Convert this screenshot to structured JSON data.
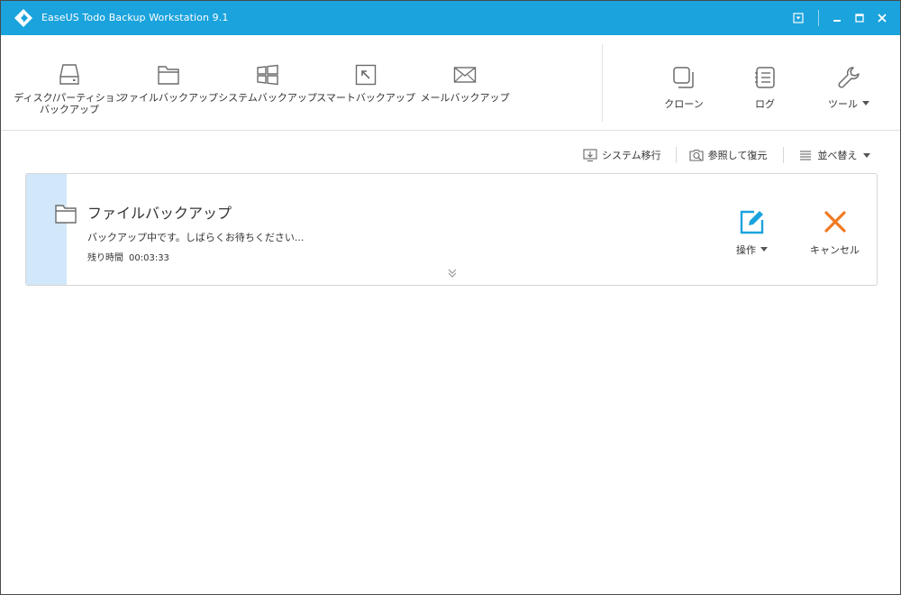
{
  "window": {
    "title": "EaseUS Todo Backup Workstation 9.1"
  },
  "toolbar": {
    "items": [
      {
        "label_line1": "ディスク/パーティション",
        "label_line2": "バックアップ",
        "icon": "disk-icon"
      },
      {
        "label": "ファイルバックアップ",
        "icon": "folder-icon"
      },
      {
        "label": "システムバックアップ",
        "icon": "windows-icon"
      },
      {
        "label": "スマートバックアップ",
        "icon": "smart-arrow-icon"
      },
      {
        "label": "メールバックアップ",
        "icon": "mail-icon"
      }
    ],
    "right_items": [
      {
        "label": "クローン",
        "icon": "clone-icon"
      },
      {
        "label": "ログ",
        "icon": "log-icon"
      },
      {
        "label": "ツール",
        "icon": "wrench-icon",
        "has_dropdown": true
      }
    ]
  },
  "actions": {
    "system_migrate": "システム移行",
    "browse_restore": "参照して復元",
    "sort": "並べ替え"
  },
  "task": {
    "title": "ファイルバックアップ",
    "status": "バックアップ中です。しばらくお待ちください...",
    "remaining_label": "残り時間",
    "remaining_time": "00:03:33",
    "operate_label": "操作",
    "cancel_label": "キャンセル"
  },
  "colors": {
    "titlebar": "#1ba3dd",
    "strip": "#d2e8fa",
    "edit_accent": "#1ba3dd",
    "cancel_accent": "#f07a22",
    "icon_gray": "#6b6b6b"
  }
}
